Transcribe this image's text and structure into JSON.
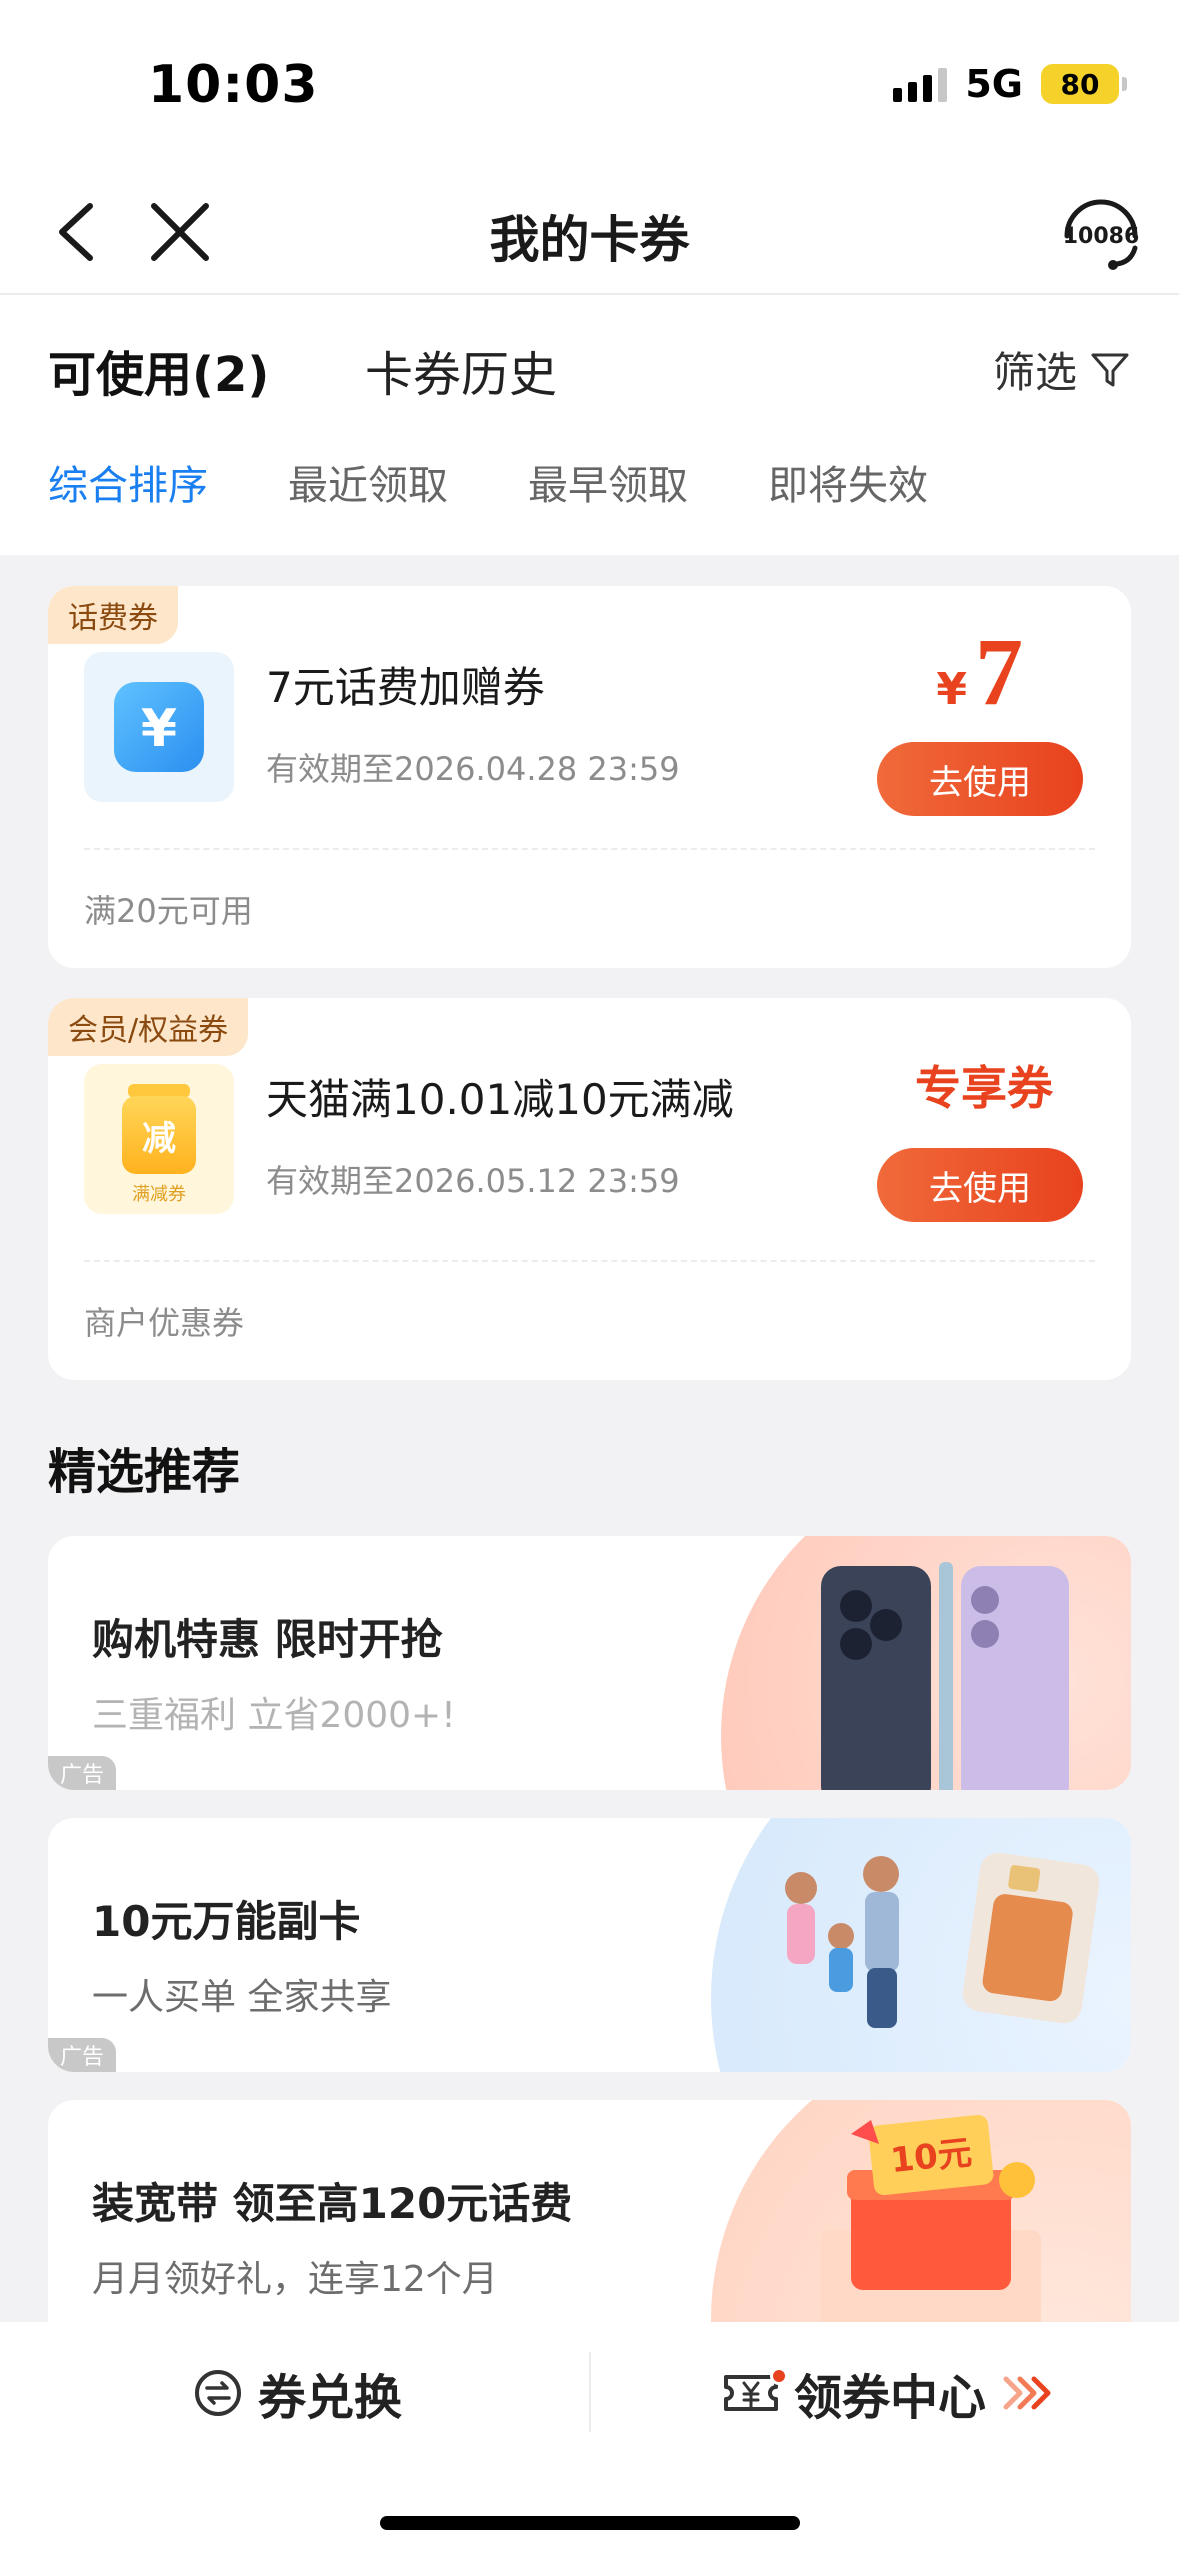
{
  "status": {
    "time": "10:03",
    "network": "5G",
    "battery": "80"
  },
  "nav": {
    "title": "我的卡券",
    "service_label": "10086"
  },
  "tabs": {
    "available": "可使用(2)",
    "history": "卡券历史",
    "filter": "筛选",
    "sort": [
      "综合排序",
      "最近领取",
      "最早领取",
      "即将失效"
    ]
  },
  "coupons": [
    {
      "tag": "话费券",
      "title": "7元话费加赠券",
      "valid": "有效期至2026.04.28 23:59",
      "note": "满20元可用",
      "currency": "¥",
      "amount": "7",
      "button": "去使用",
      "icon_char": "¥"
    },
    {
      "tag": "会员/权益券",
      "title": "天猫满10.01减10元满减",
      "valid": "有效期至2026.05.12 23:59",
      "note": "商户优惠券",
      "exclusive": "专享券",
      "button": "去使用",
      "icon_char": "减",
      "icon_caption": "满减券"
    }
  ],
  "section": {
    "title": "精选推荐"
  },
  "promos": [
    {
      "title": "购机特惠 限时开抢",
      "subtitle": "三重福利 立省2000+!",
      "ad": "广告"
    },
    {
      "title": "10元万能副卡",
      "subtitle": "一人买单 全家共享",
      "ad": "广告"
    },
    {
      "title": "装宽带 领至高120元话费",
      "subtitle": "月月领好礼，连享12个月",
      "art_label": "10元"
    }
  ],
  "bottom": {
    "exchange": "券兑换",
    "center": "领券中心"
  },
  "colors": {
    "accent_blue": "#1a7ff0",
    "accent_red": "#e8421e",
    "tag_bg": "#fde6c9"
  }
}
